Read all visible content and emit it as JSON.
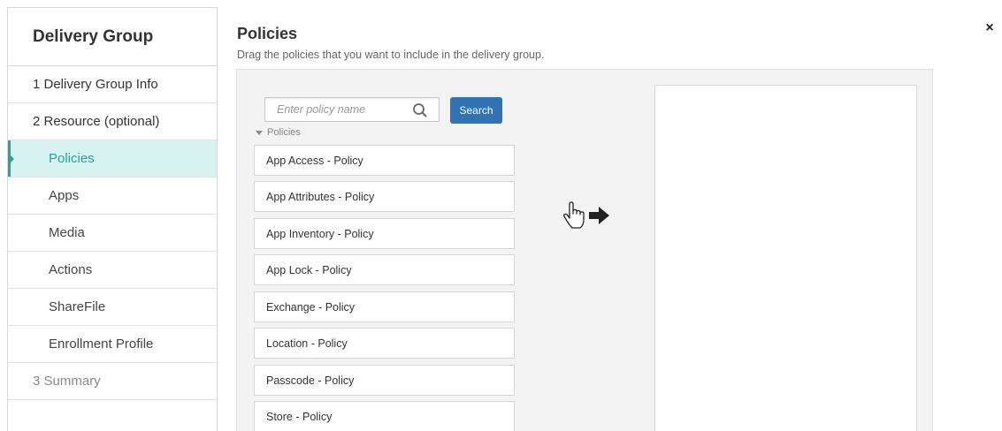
{
  "sidebar": {
    "title": "Delivery Group",
    "items": [
      {
        "label": "1  Delivery Group Info"
      },
      {
        "label": "2  Resource (optional)"
      },
      {
        "label": "Policies"
      },
      {
        "label": "Apps"
      },
      {
        "label": "Media"
      },
      {
        "label": "Actions"
      },
      {
        "label": "ShareFile"
      },
      {
        "label": "Enrollment Profile"
      },
      {
        "label": "3  Summary"
      }
    ]
  },
  "header": {
    "title": "Policies",
    "subtitle": "Drag the policies that you want to include in the delivery group.",
    "close_glyph": "×"
  },
  "search": {
    "placeholder": "Enter policy name",
    "button_label": "Search"
  },
  "policies_group_label": "Policies",
  "policies": [
    "App Access - Policy",
    "App Attributes - Policy",
    "App Inventory - Policy",
    "App Lock - Policy",
    "Exchange - Policy",
    "Location - Policy",
    "Passcode - Policy",
    "Store - Policy"
  ],
  "colors": {
    "accent_teal": "#2aa397",
    "active_bg": "#d6f3f1",
    "search_button": "#2f73b7"
  },
  "icons": {
    "drag_hint": "hand-pointer-arrow-right-icon",
    "search": "magnifier-icon",
    "close": "close-icon"
  }
}
